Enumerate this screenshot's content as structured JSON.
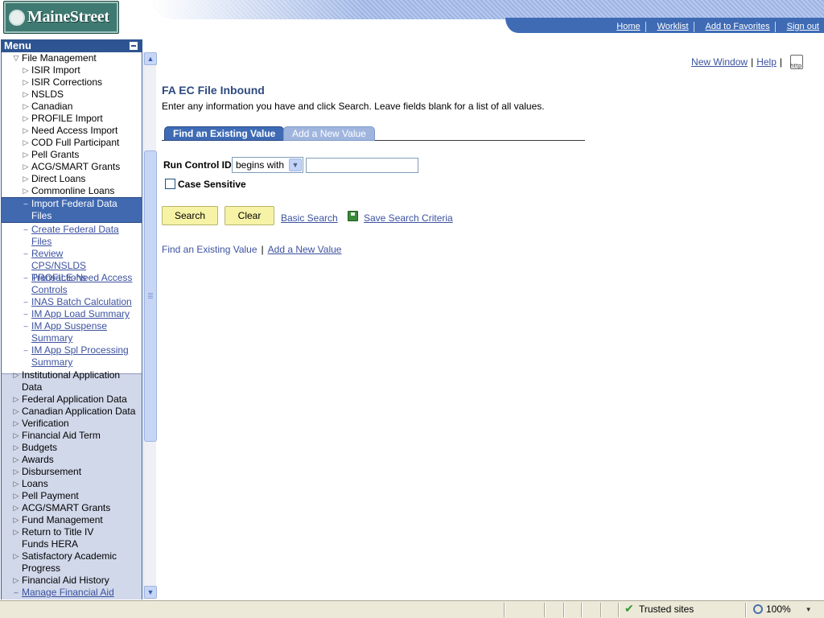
{
  "header": {
    "logo_text": "MaineStreet",
    "nav": [
      "Home",
      "Worklist",
      "Add to Favorites",
      "Sign out"
    ]
  },
  "menu": {
    "title": "Menu",
    "items": [
      {
        "label": "File Management",
        "icon": "triangle-down",
        "level": 0
      },
      {
        "label": "ISIR Import",
        "icon": "triangle-right",
        "level": 1
      },
      {
        "label": "ISIR Corrections",
        "icon": "triangle-right",
        "level": 1
      },
      {
        "label": "NSLDS",
        "icon": "triangle-right",
        "level": 1
      },
      {
        "label": "Canadian",
        "icon": "triangle-right",
        "level": 1
      },
      {
        "label": "PROFILE Import",
        "icon": "triangle-right",
        "level": 1
      },
      {
        "label": "Need Access Import",
        "icon": "triangle-right",
        "level": 1
      },
      {
        "label": "COD Full Participant",
        "icon": "triangle-right",
        "level": 1
      },
      {
        "label": "Pell Grants",
        "icon": "triangle-right",
        "level": 1
      },
      {
        "label": "ACG/SMART Grants",
        "icon": "triangle-right",
        "level": 1
      },
      {
        "label": "Direct Loans",
        "icon": "triangle-right",
        "level": 1
      },
      {
        "label": "Commonline Loans",
        "icon": "triangle-right",
        "level": 1
      },
      {
        "label": "Import Federal Data Files",
        "icon": "dash",
        "level": 1,
        "active": true
      },
      {
        "label": "Create Federal Data Files",
        "icon": "dash",
        "level": 1,
        "link": true
      },
      {
        "label": "Review CPS/NSLDS Transactions",
        "icon": "dash",
        "level": 1,
        "link": true
      },
      {
        "label": "PROFILE-Need Access Controls",
        "icon": "dash",
        "level": 1,
        "link": true
      },
      {
        "label": "INAS Batch Calculation",
        "icon": "dash",
        "level": 1,
        "link": true
      },
      {
        "label": "IM App Load Summary",
        "icon": "dash",
        "level": 1,
        "link": true
      },
      {
        "label": "IM App Suspense Summary",
        "icon": "dash",
        "level": 1,
        "link": true
      },
      {
        "label": "IM App Spl Processing Summary",
        "icon": "dash",
        "level": 1,
        "link": true
      },
      {
        "label": "Institutional Application Data",
        "icon": "triangle-right",
        "level": 0
      },
      {
        "label": "Federal Application Data",
        "icon": "triangle-right",
        "level": 0
      },
      {
        "label": "Canadian Application Data",
        "icon": "triangle-right",
        "level": 0
      },
      {
        "label": "Verification",
        "icon": "triangle-right",
        "level": 0
      },
      {
        "label": "Financial Aid Term",
        "icon": "triangle-right",
        "level": 0
      },
      {
        "label": "Budgets",
        "icon": "triangle-right",
        "level": 0
      },
      {
        "label": "Awards",
        "icon": "triangle-right",
        "level": 0
      },
      {
        "label": "Disbursement",
        "icon": "triangle-right",
        "level": 0
      },
      {
        "label": "Loans",
        "icon": "triangle-right",
        "level": 0
      },
      {
        "label": "Pell Payment",
        "icon": "triangle-right",
        "level": 0
      },
      {
        "label": "ACG/SMART Grants",
        "icon": "triangle-right",
        "level": 0
      },
      {
        "label": "Fund Management",
        "icon": "triangle-right",
        "level": 0
      },
      {
        "label": "Return to Title IV Funds HERA",
        "icon": "triangle-right",
        "level": 0
      },
      {
        "label": "Satisfactory Academic Progress",
        "icon": "triangle-right",
        "level": 0
      },
      {
        "label": "Financial Aid History",
        "icon": "triangle-right",
        "level": 0
      },
      {
        "label": "Manage Financial Aid",
        "icon": "dash",
        "level": 0,
        "link": true
      }
    ]
  },
  "content": {
    "new_window": "New Window",
    "help": "Help",
    "title": "FA EC File Inbound",
    "instructions": "Enter any information you have and click Search. Leave fields blank for a list of all values.",
    "tabs": [
      "Find an Existing Value",
      "Add a New Value"
    ],
    "run_control_label": "Run Control ID:",
    "run_control_operator": "begins with",
    "run_control_value": "",
    "case_sensitive_label": "Case Sensitive",
    "search_button": "Search",
    "clear_button": "Clear",
    "basic_search": "Basic Search",
    "save_search": "Save Search Criteria",
    "bottom_find": "Find an Existing Value",
    "bottom_add": "Add a New Value"
  },
  "statusbar": {
    "zone": "Trusted sites",
    "zoom": "100%"
  }
}
